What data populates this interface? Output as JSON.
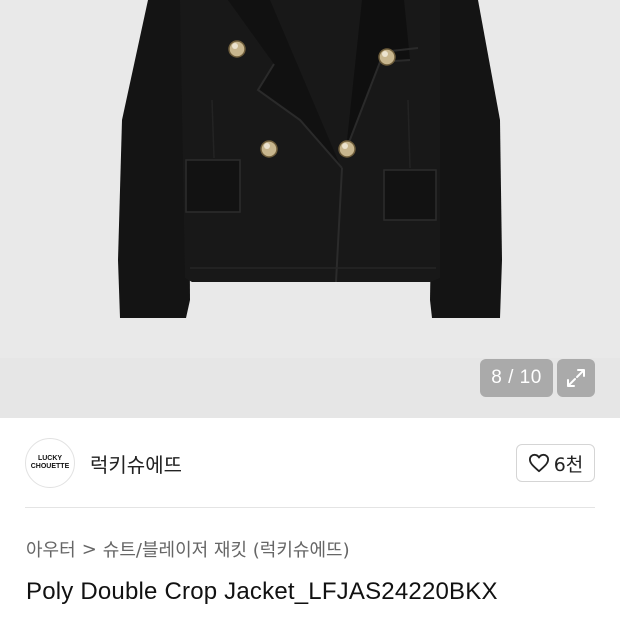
{
  "gallery": {
    "current_index": 8,
    "total": 10,
    "counter_label": "8 / 10",
    "expand_icon": "expand-icon"
  },
  "brand": {
    "logo_line1": "LUCKY",
    "logo_line2": "CHOUETTE",
    "name": "럭키슈에뜨"
  },
  "like": {
    "icon": "heart-icon",
    "count_label": "6천"
  },
  "breadcrumb": {
    "items": [
      "아우터",
      "슈트/블레이저 재킷 (럭키슈에뜨)"
    ],
    "separator": ">"
  },
  "product": {
    "title": "Poly Double Crop Jacket_LFJAS24220BKX"
  },
  "colors": {
    "gallery_bg": "#e9e9e9",
    "jacket": "#151515",
    "button_gold": "#b9a47a"
  }
}
